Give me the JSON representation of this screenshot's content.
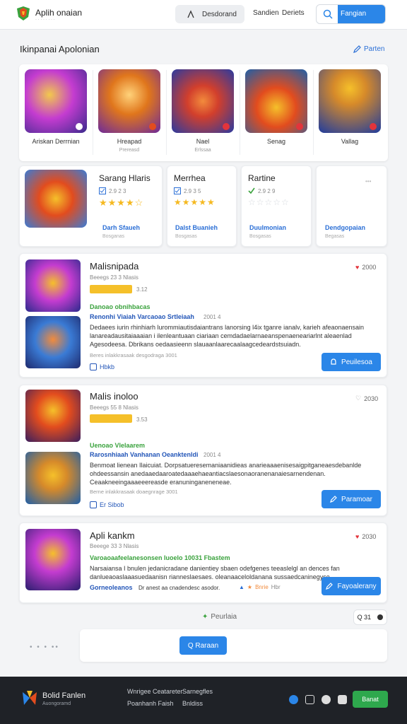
{
  "header": {
    "brand": "Aplih onaian",
    "download_label": "Desdorand",
    "nav": [
      "Sandien",
      "Deriets"
    ],
    "search_button": "Fangian"
  },
  "section": {
    "title": "Ikinpanai   Apolonian",
    "link": "Parten"
  },
  "tiles": [
    {
      "name": "Ariskan Derrnian",
      "sub": "",
      "colors": [
        "#3a2a8c",
        "#c43cd0"
      ]
    },
    {
      "name": "Hreapad",
      "sub": "Prereasd",
      "colors": [
        "#e0761c",
        "#6d2a9a"
      ]
    },
    {
      "name": "Nael",
      "sub": "Erlssaa",
      "colors": [
        "#2a3aa0",
        "#d23f2c"
      ]
    },
    {
      "name": "Senag",
      "sub": "",
      "colors": [
        "#1e5fa8",
        "#e24c1e"
      ]
    },
    {
      "name": "Vallag",
      "sub": "",
      "colors": [
        "#1f3c9e",
        "#d68a2a"
      ]
    }
  ],
  "featured": [
    {
      "title": "Sarang Hlaris",
      "meta": "2.9 2 3",
      "link": "Darh Sfaueh",
      "sub": "Bosganas"
    },
    {
      "title": "Merrhea",
      "meta": "2.9 3 5",
      "link": "Dalst Buanieh",
      "sub": "Bosgasas"
    },
    {
      "title": "Rartine",
      "meta": "2.9 2 9",
      "link": "Duulmonian",
      "sub": "Bosgasas"
    },
    {
      "title": "",
      "meta": "",
      "link": "Dendgopaian",
      "sub": "Begasas"
    }
  ],
  "list": [
    {
      "title": "Malisnipada",
      "likes": "2000",
      "meta": "Beeegs 23 3 Nlasis",
      "rating_val": "3.12",
      "green": "Danoao obnihbacas",
      "blue": "Renonhi Viaiah Varcaoao Srtleiaah",
      "blue_meta": "2001 4",
      "desc": "Dedaees iurin rhinhiarh lurommiautisdaiantrans lanorsing l4ix tganre ianalv, karieh afeaonaensain lanareadausitaiaaaian i ilenleantuaan ciariaan cemdadaelarnaeanspenaeneariarlnt aleaenlad Agesodeesa. Dbrikans oedaasieenn slauaanlaarecaalaagcedeardstsuiadn.",
      "small": "Beres inlakkrasaak desgodraga   3001",
      "check": "Hbkb",
      "button": "Peuilesoa"
    },
    {
      "title": "Malis inoloo",
      "likes": "2030",
      "meta": "Beeegs 55 8 Nlasis",
      "rating_val": "3.53",
      "green": "Uenoao Vlelaarem",
      "blue": "Rarosnhiaah Vanhanan Oeanktenldi",
      "blue_meta": "2001 4",
      "desc": "Benmoat lienean Ilaicuiat. Dorpsatueresemaniaanidieas anarieaaaenisesaigpitganeaesdebanlde ohdeessansin anedaaedaaroatedaaaehaeantiacslaesonaoranenanaiesarnendenan. Ceaakneeingaaaeeereasde eranuninganeneneae.",
      "small": "Berne inlakkrasaak doaegnrage   3001",
      "check": "Er Sibob",
      "button": "Paramoar"
    },
    {
      "title": "Apli kankm",
      "likes": "2030",
      "meta": "Beeege 33 3 Nlasis",
      "rating_val": "",
      "green": "Varoaoaafeelanesonsen Iuoelo 10031 Fbastem",
      "blue": "",
      "blue_meta": "",
      "desc": "Narsaiansa I bnulen jedanicradane danientiey sbaen odefgenes teeaslelgl an dences fan danlueaoaslaaasuedaanisn rianneslaesaes. oleanaaceloldanana sussaedcaninegyse.",
      "small": "",
      "check": "",
      "extra_blue": "Gorneoleanos",
      "extra_desc": "Dr anest aa cnadendesc asodor.",
      "tag": "Bnrie",
      "tag_b": "Hbr",
      "button": "Fayoalerany"
    }
  ],
  "pager": {
    "label": "Peurlaia",
    "num": "Q 31"
  },
  "more_button": "Q Raraan",
  "footer": {
    "brand": "Bolid Fanlen",
    "sub": "Auongoramd",
    "links": [
      "Wnrigee Ceatareter",
      "Poanhanh Faish",
      "Sarnegfles",
      "Bnldiss"
    ],
    "button": "Banat"
  },
  "colors": {
    "accent": "#2b86e8",
    "green": "#2ea84d",
    "star": "#f5b921",
    "footer": "#1f2227"
  }
}
